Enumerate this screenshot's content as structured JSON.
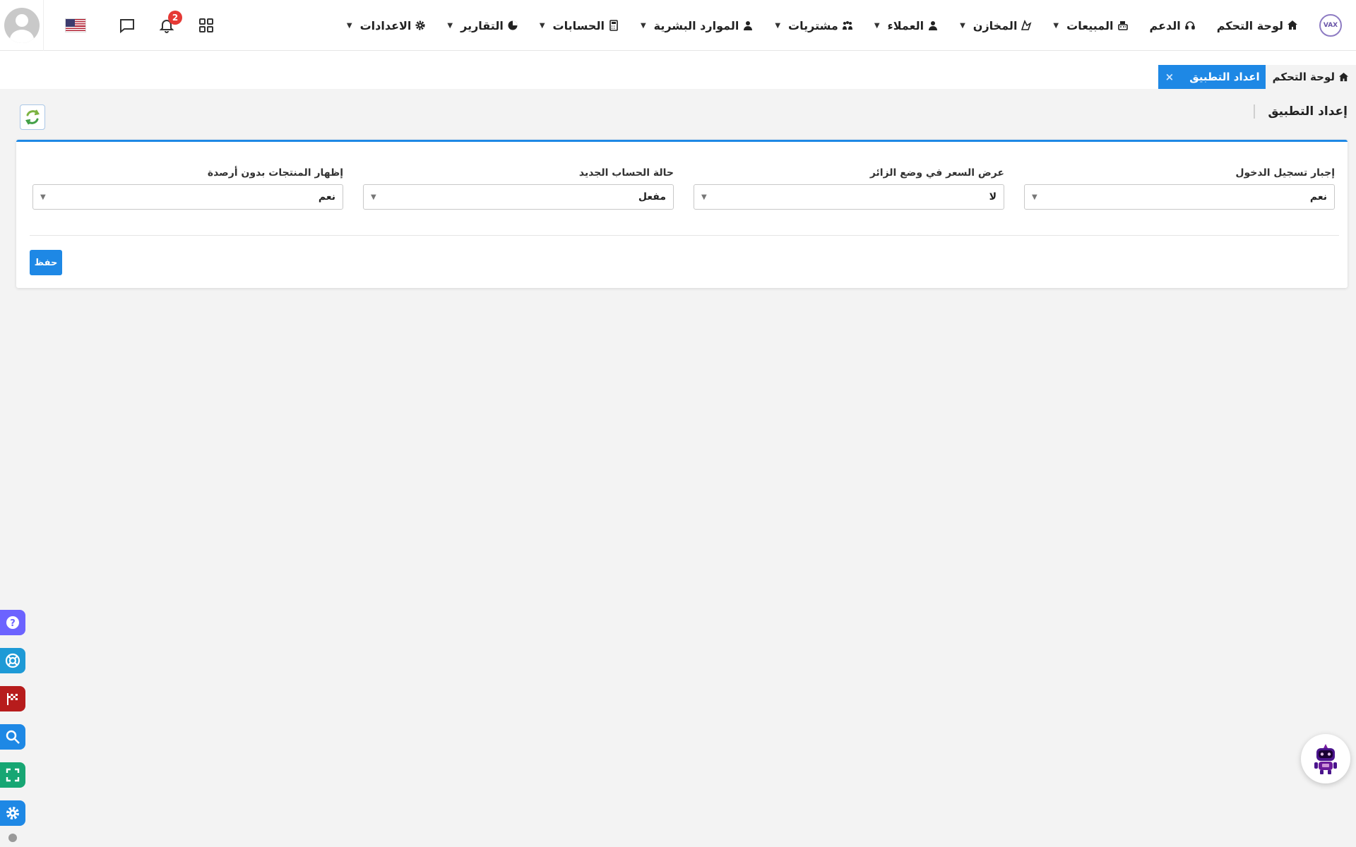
{
  "navbar": {
    "logo_text": "VAX",
    "notification_count": "2",
    "menu": [
      {
        "label": "لوحة التحكم",
        "icon": "home-icon",
        "dropdown": false
      },
      {
        "label": "الدعم",
        "icon": "headset-icon",
        "dropdown": false
      },
      {
        "label": "المبيعات",
        "icon": "cash-register-icon",
        "dropdown": true
      },
      {
        "label": "المخازن",
        "icon": "warehouse-icon",
        "dropdown": true
      },
      {
        "label": "العملاء",
        "icon": "user-icon",
        "dropdown": true
      },
      {
        "label": "مشتريات",
        "icon": "people-icon",
        "dropdown": true
      },
      {
        "label": "الموارد البشرية",
        "icon": "users-icon",
        "dropdown": true
      },
      {
        "label": "الحسابات",
        "icon": "calculator-icon",
        "dropdown": true
      },
      {
        "label": "التقارير",
        "icon": "pie-chart-icon",
        "dropdown": true
      },
      {
        "label": "الاعدادات",
        "icon": "gear-icon",
        "dropdown": true
      }
    ]
  },
  "tabs": {
    "home_label": "لوحة التحكم",
    "active_label": "اعداد التطبيق",
    "close_symbol": "×"
  },
  "page": {
    "title": "إعداد التطبيق"
  },
  "form": {
    "fields": [
      {
        "label": "إجبار تسجيل الدخول",
        "value": "نعم"
      },
      {
        "label": "عرض السعر في وضع الزائر",
        "value": "لا"
      },
      {
        "label": "حالة الحساب الجديد",
        "value": "مفعل"
      },
      {
        "label": "إظهار المنتجات بدون أرصدة",
        "value": "نعم"
      }
    ],
    "save_label": "حفظ"
  },
  "colors": {
    "accent": "#1e88e5",
    "badge": "#e53935"
  },
  "side_tools": [
    {
      "icon": "question-icon",
      "color": "#6c63ff"
    },
    {
      "icon": "lifebuoy-icon",
      "color": "#1e9ad6"
    },
    {
      "icon": "checkered-flag-icon",
      "color": "#b71c1c"
    },
    {
      "icon": "search-icon",
      "color": "#1e88e5"
    },
    {
      "icon": "fullscreen-icon",
      "color": "#17a673"
    },
    {
      "icon": "gear-icon",
      "color": "#1e88e5"
    }
  ]
}
